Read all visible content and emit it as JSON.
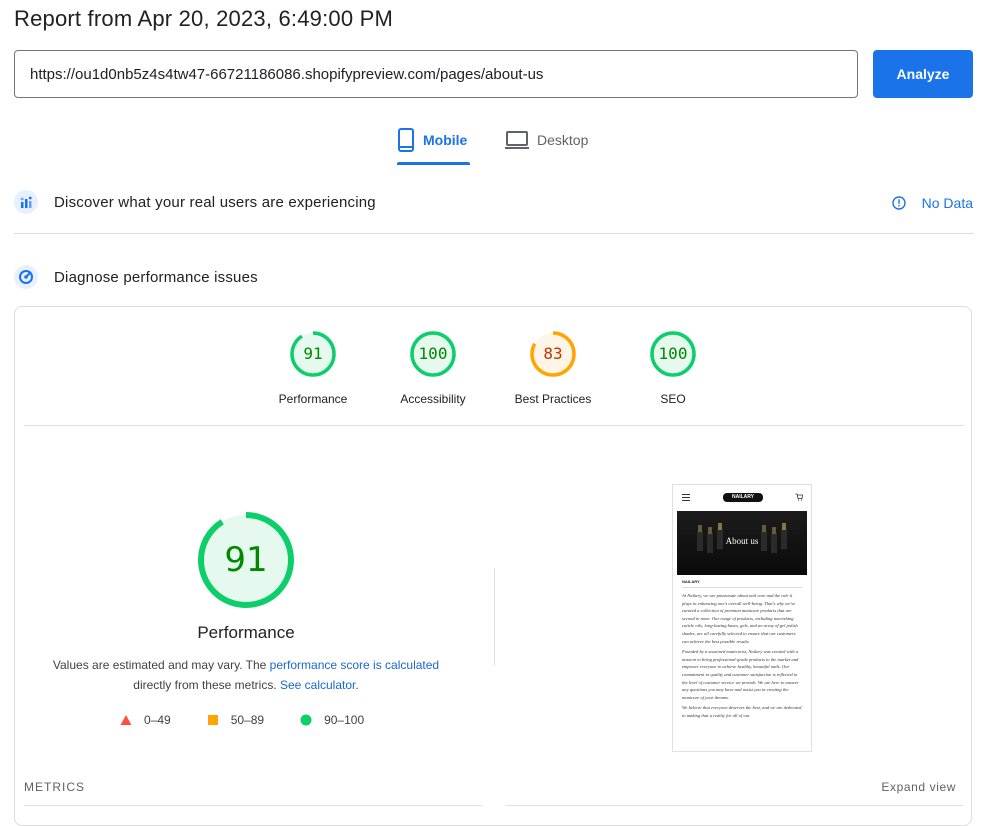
{
  "header": {
    "title": "Report from Apr 20, 2023, 6:49:00 PM"
  },
  "url_input": {
    "value": "https://ou1d0nb5z4s4tw47-66721186086.shopifypreview.com/pages/about-us"
  },
  "analyze_button": {
    "label": "Analyze"
  },
  "tabs": [
    {
      "label": "Mobile",
      "icon": "smartphone-icon",
      "active": true
    },
    {
      "label": "Desktop",
      "icon": "desktop-icon",
      "active": false
    }
  ],
  "sections": {
    "real_users": {
      "title": "Discover what your real users are experiencing",
      "status": "No Data"
    },
    "diagnose": {
      "title": "Diagnose performance issues"
    }
  },
  "scores": [
    {
      "label": "Performance",
      "value": "91",
      "score": 91,
      "color": "#0cce6b",
      "text_color": "#008800",
      "bg": "#e6f9ee"
    },
    {
      "label": "Accessibility",
      "value": "100",
      "score": 100,
      "color": "#0cce6b",
      "text_color": "#008800",
      "bg": "#e6f9ee"
    },
    {
      "label": "Best Practices",
      "value": "83",
      "score": 83,
      "color": "#ffa400",
      "text_color": "#c33300",
      "bg": "#fff5e6"
    },
    {
      "label": "SEO",
      "value": "100",
      "score": 100,
      "color": "#0cce6b",
      "text_color": "#008800",
      "bg": "#e6f9ee"
    }
  ],
  "performance": {
    "value": "91",
    "score": 91,
    "label": "Performance",
    "note_prefix": "Values are estimated and may vary. The ",
    "note_link1": "performance score is calculated",
    "note_mid": " directly from these metrics. ",
    "note_link2": "See calculator",
    "note_suffix": "."
  },
  "legend": [
    {
      "range": "0–49",
      "shape": "triangle",
      "color": "#ff4e42"
    },
    {
      "range": "50–89",
      "shape": "square",
      "color": "#ffa400"
    },
    {
      "range": "90–100",
      "shape": "circle",
      "color": "#0cce6b"
    }
  ],
  "screenshot": {
    "brand": "NAILARY",
    "hero_text": "About us",
    "section_label": "NAILARY",
    "paragraphs": [
      "At Nailary, we are passionate about nail care and the role it plays in enhancing one's overall well-being. That's why we've curated a collection of premium manicure products that are second to none. Our range of products, including nourishing cuticle oils, long-lasting bases, gels, and an array of gel polish shades, are all carefully selected to ensure that our customers can achieve the best possible results.",
      "Founded by a seasoned manicurist, Nailary was created with a mission to bring professional-grade products to the market and empower everyone to achieve healthy, beautiful nails. Our commitment to quality and customer satisfaction is reflected in the level of customer service we provide. We are here to answer any questions you may have and assist you in creating the manicure of your dreams.",
      "We believe that everyone deserves the best, and we are dedicated to making that a reality for all of our"
    ]
  },
  "metrics": {
    "label": "METRICS",
    "expand_label": "Expand view"
  }
}
